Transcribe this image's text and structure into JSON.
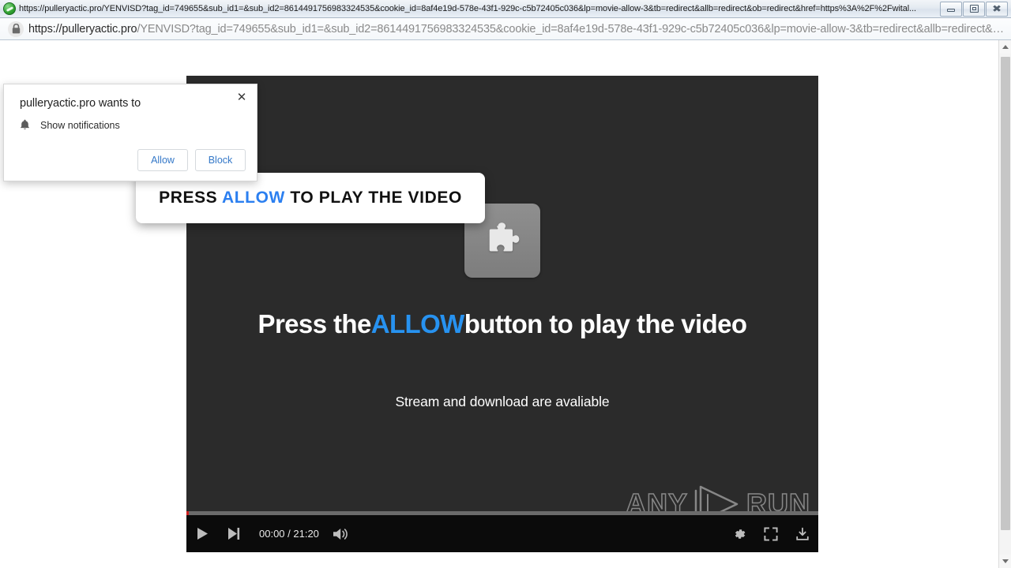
{
  "window": {
    "title": "https://pulleryactic.pro/YENVISD?tag_id=749655&sub_id1=&sub_id2=8614491756983324535&cookie_id=8af4e19d-578e-43f1-929c-c5b72405c036&lp=movie-allow-3&tb=redirect&allb=redirect&ob=redirect&href=https%3A%2F%2Fwital...",
    "icon": "globe-icon",
    "minimize_label": "Minimize",
    "maximize_label": "Restore",
    "close_label": "Close"
  },
  "address_bar": {
    "lock_icon": "padlock-icon",
    "url_host": "https://pulleryactic.pro",
    "url_path": "/YENVISD?tag_id=749655&sub_id1=&sub_id2=8614491756983324535&cookie_id=8af4e19d-578e-43f1-929c-c5b72405c036&lp=movie-allow-3&tb=redirect&allb=redirect&…"
  },
  "notification_popup": {
    "heading": "pulleryactic.pro wants to",
    "permission_icon": "bell-icon",
    "permission_label": "Show notifications",
    "allow_label": "Allow",
    "block_label": "Block",
    "close_icon": "close-icon"
  },
  "tooltip": {
    "prefix": "PRESS ",
    "highlight": "ALLOW",
    "suffix": " TO PLAY THE VIDEO"
  },
  "video": {
    "plugin_icon": "puzzle-piece-icon",
    "title_prefix": "Press the",
    "title_highlight": "ALLOW",
    "title_suffix": "button to play the video",
    "subtitle": "Stream and download are avaliable",
    "watermark_text_left": "ANY",
    "watermark_text_right": "RUN",
    "watermark_icon": "play-triangle-icon"
  },
  "player_controls": {
    "play_icon": "play-icon",
    "next_icon": "next-track-icon",
    "time_display": "00:00 / 21:20",
    "current_time": "00:00",
    "duration": "21:20",
    "volume_icon": "volume-high-icon",
    "settings_icon": "gear-icon",
    "fullscreen_icon": "fullscreen-icon",
    "download_icon": "download-icon",
    "progress_percent": 0
  },
  "scrollbar": {
    "up_icon": "chevron-up-icon",
    "down_icon": "chevron-down-icon"
  },
  "colors": {
    "accent_blue": "#2792f0",
    "link_blue": "#3478c8",
    "video_bg": "#2b2b2b",
    "control_bg": "#0b0b0b",
    "progress_red": "#cc1f1f"
  }
}
